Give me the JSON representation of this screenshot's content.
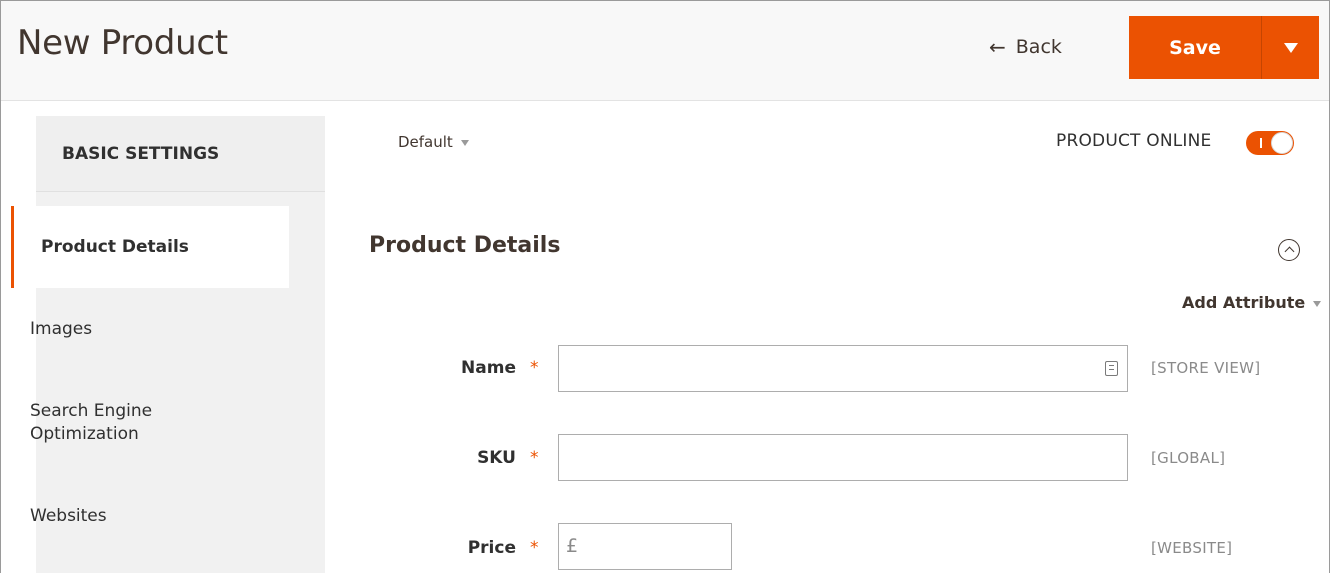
{
  "header": {
    "title": "New Product",
    "back_label": "Back",
    "back_arrow": "←",
    "save_label": "Save",
    "accent_color": "#eb5202"
  },
  "sidebar": {
    "heading": "BASIC SETTINGS",
    "items": [
      {
        "label": "Product Details",
        "active": true
      },
      {
        "label": "Images",
        "active": false
      },
      {
        "label": "Search Engine Optimization",
        "active": false
      },
      {
        "label": "Websites",
        "active": false
      }
    ]
  },
  "content": {
    "store_switcher": "Default",
    "product_online_label": "PRODUCT ONLINE",
    "product_online": true,
    "section_title": "Product Details",
    "add_attribute_label": "Add Attribute",
    "fields": {
      "name": {
        "label": "Name",
        "required_mark": "*",
        "value": "",
        "scope": "[STORE VIEW]"
      },
      "sku": {
        "label": "SKU",
        "required_mark": "*",
        "value": "",
        "scope": "[GLOBAL]"
      },
      "price": {
        "label": "Price",
        "required_mark": "*",
        "value": "",
        "currency_symbol": "£",
        "scope": "[WEBSITE]"
      }
    }
  }
}
